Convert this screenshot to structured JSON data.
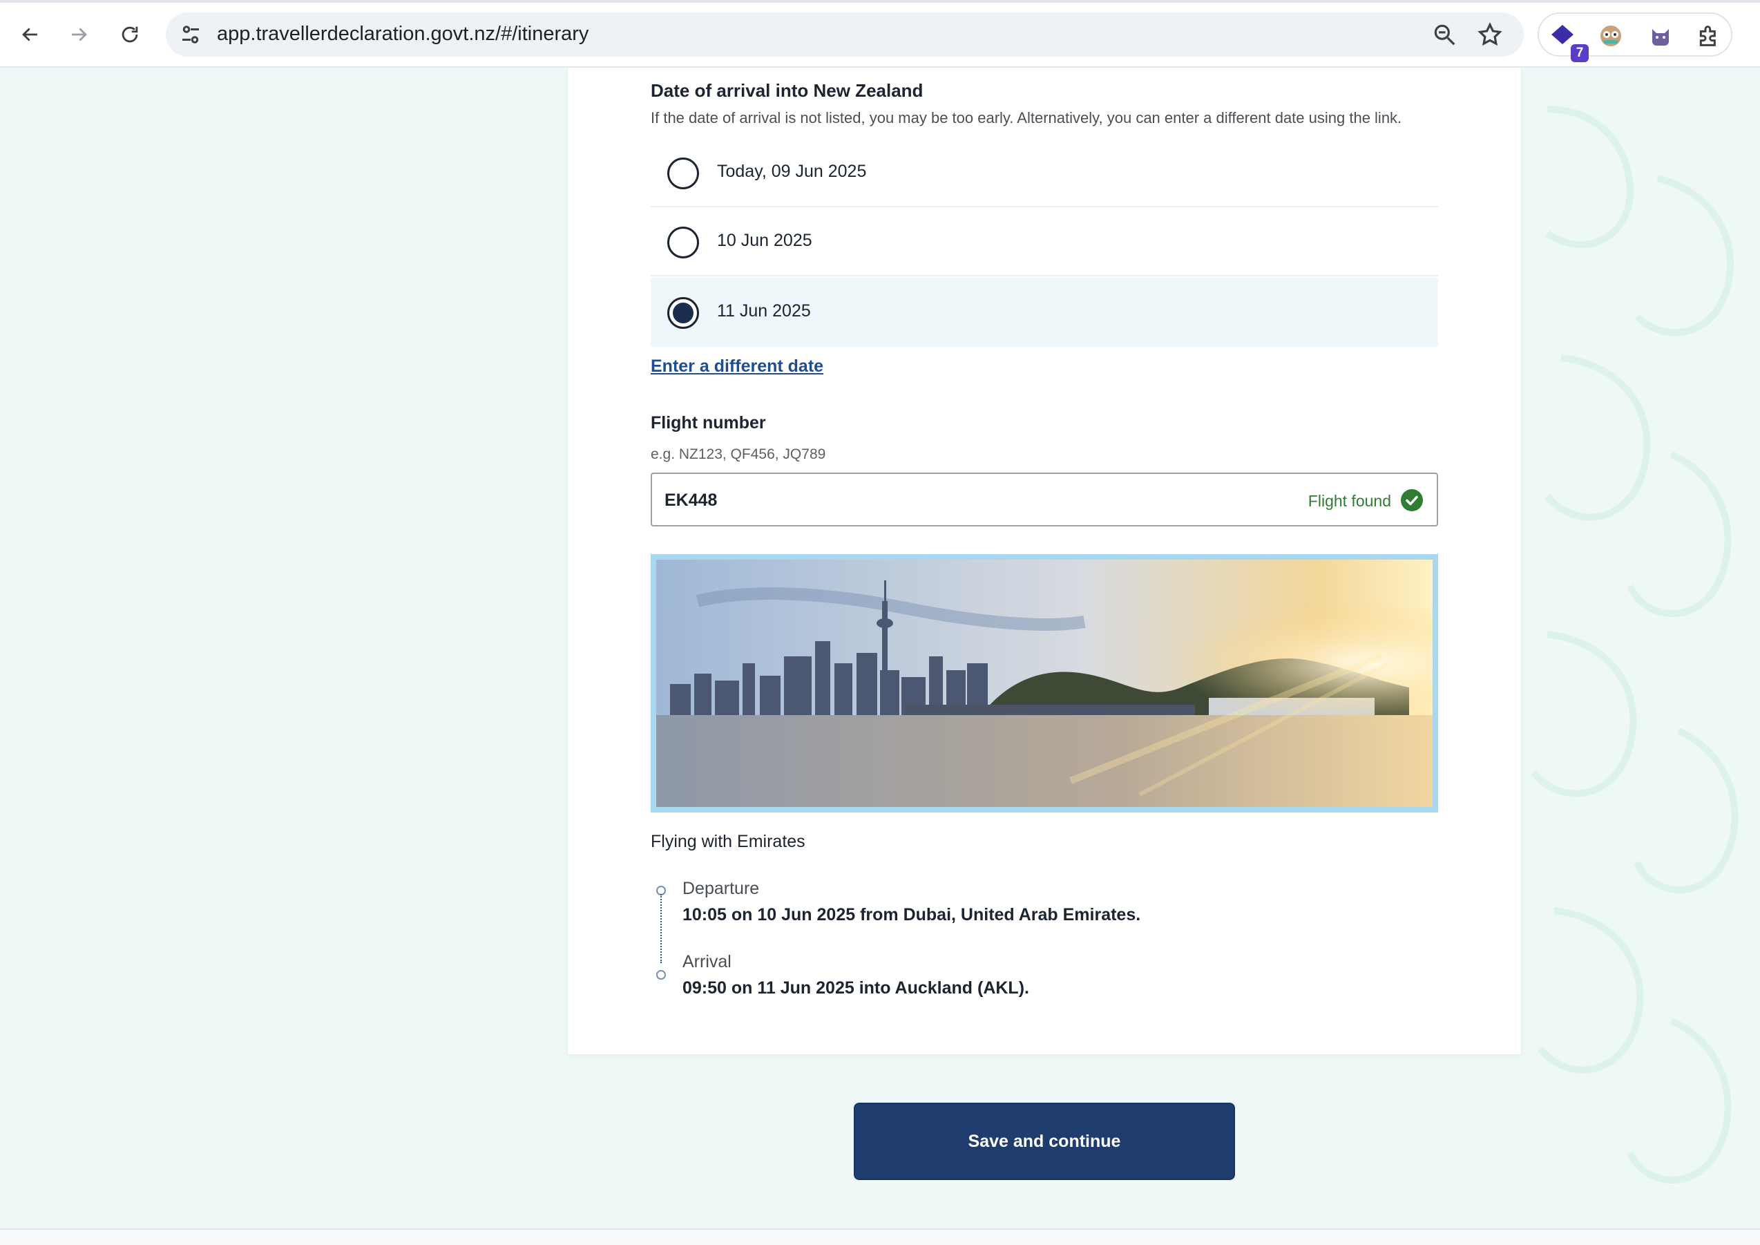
{
  "browser": {
    "url": "app.travellerdeclaration.govt.nz/#/itinerary",
    "extension_badge": "7",
    "icons": [
      "back-icon",
      "forward-icon",
      "reload-icon",
      "site-settings-icon",
      "zoom-icon",
      "bookmark-star-icon",
      "extension-app-icon",
      "extension-owl-icon",
      "extension-cat-icon",
      "extensions-puzzle-icon"
    ]
  },
  "arrival": {
    "title": "Date of arrival into New Zealand",
    "hint": "If the date of arrival is not listed, you may be too early. Alternatively, you can enter a different date using the link.",
    "options": [
      {
        "label": "Today, 09 Jun 2025",
        "selected": false
      },
      {
        "label": "10 Jun 2025",
        "selected": false
      },
      {
        "label": "11 Jun 2025",
        "selected": true
      }
    ],
    "different_date_link": "Enter a different date"
  },
  "flight": {
    "label": "Flight number",
    "hint": "e.g. NZ123, QF456, JQ789",
    "value": "EK448",
    "status": "Flight found",
    "status_color": "#2e7d32"
  },
  "itinerary": {
    "airline_text": "Flying with Emirates",
    "departure_heading": "Departure",
    "departure_detail": "10:05 on 10 Jun 2025 from Dubai, United Arab Emirates.",
    "arrival_heading": "Arrival",
    "arrival_detail": "09:50 on 11 Jun 2025 into Auckland (AKL)."
  },
  "actions": {
    "save_label": "Save and continue"
  },
  "colors": {
    "primary": "#1f3c6e",
    "link": "#1f4e8c",
    "selected_bg": "#eef8fa",
    "page_bg": "#eef8f7"
  }
}
